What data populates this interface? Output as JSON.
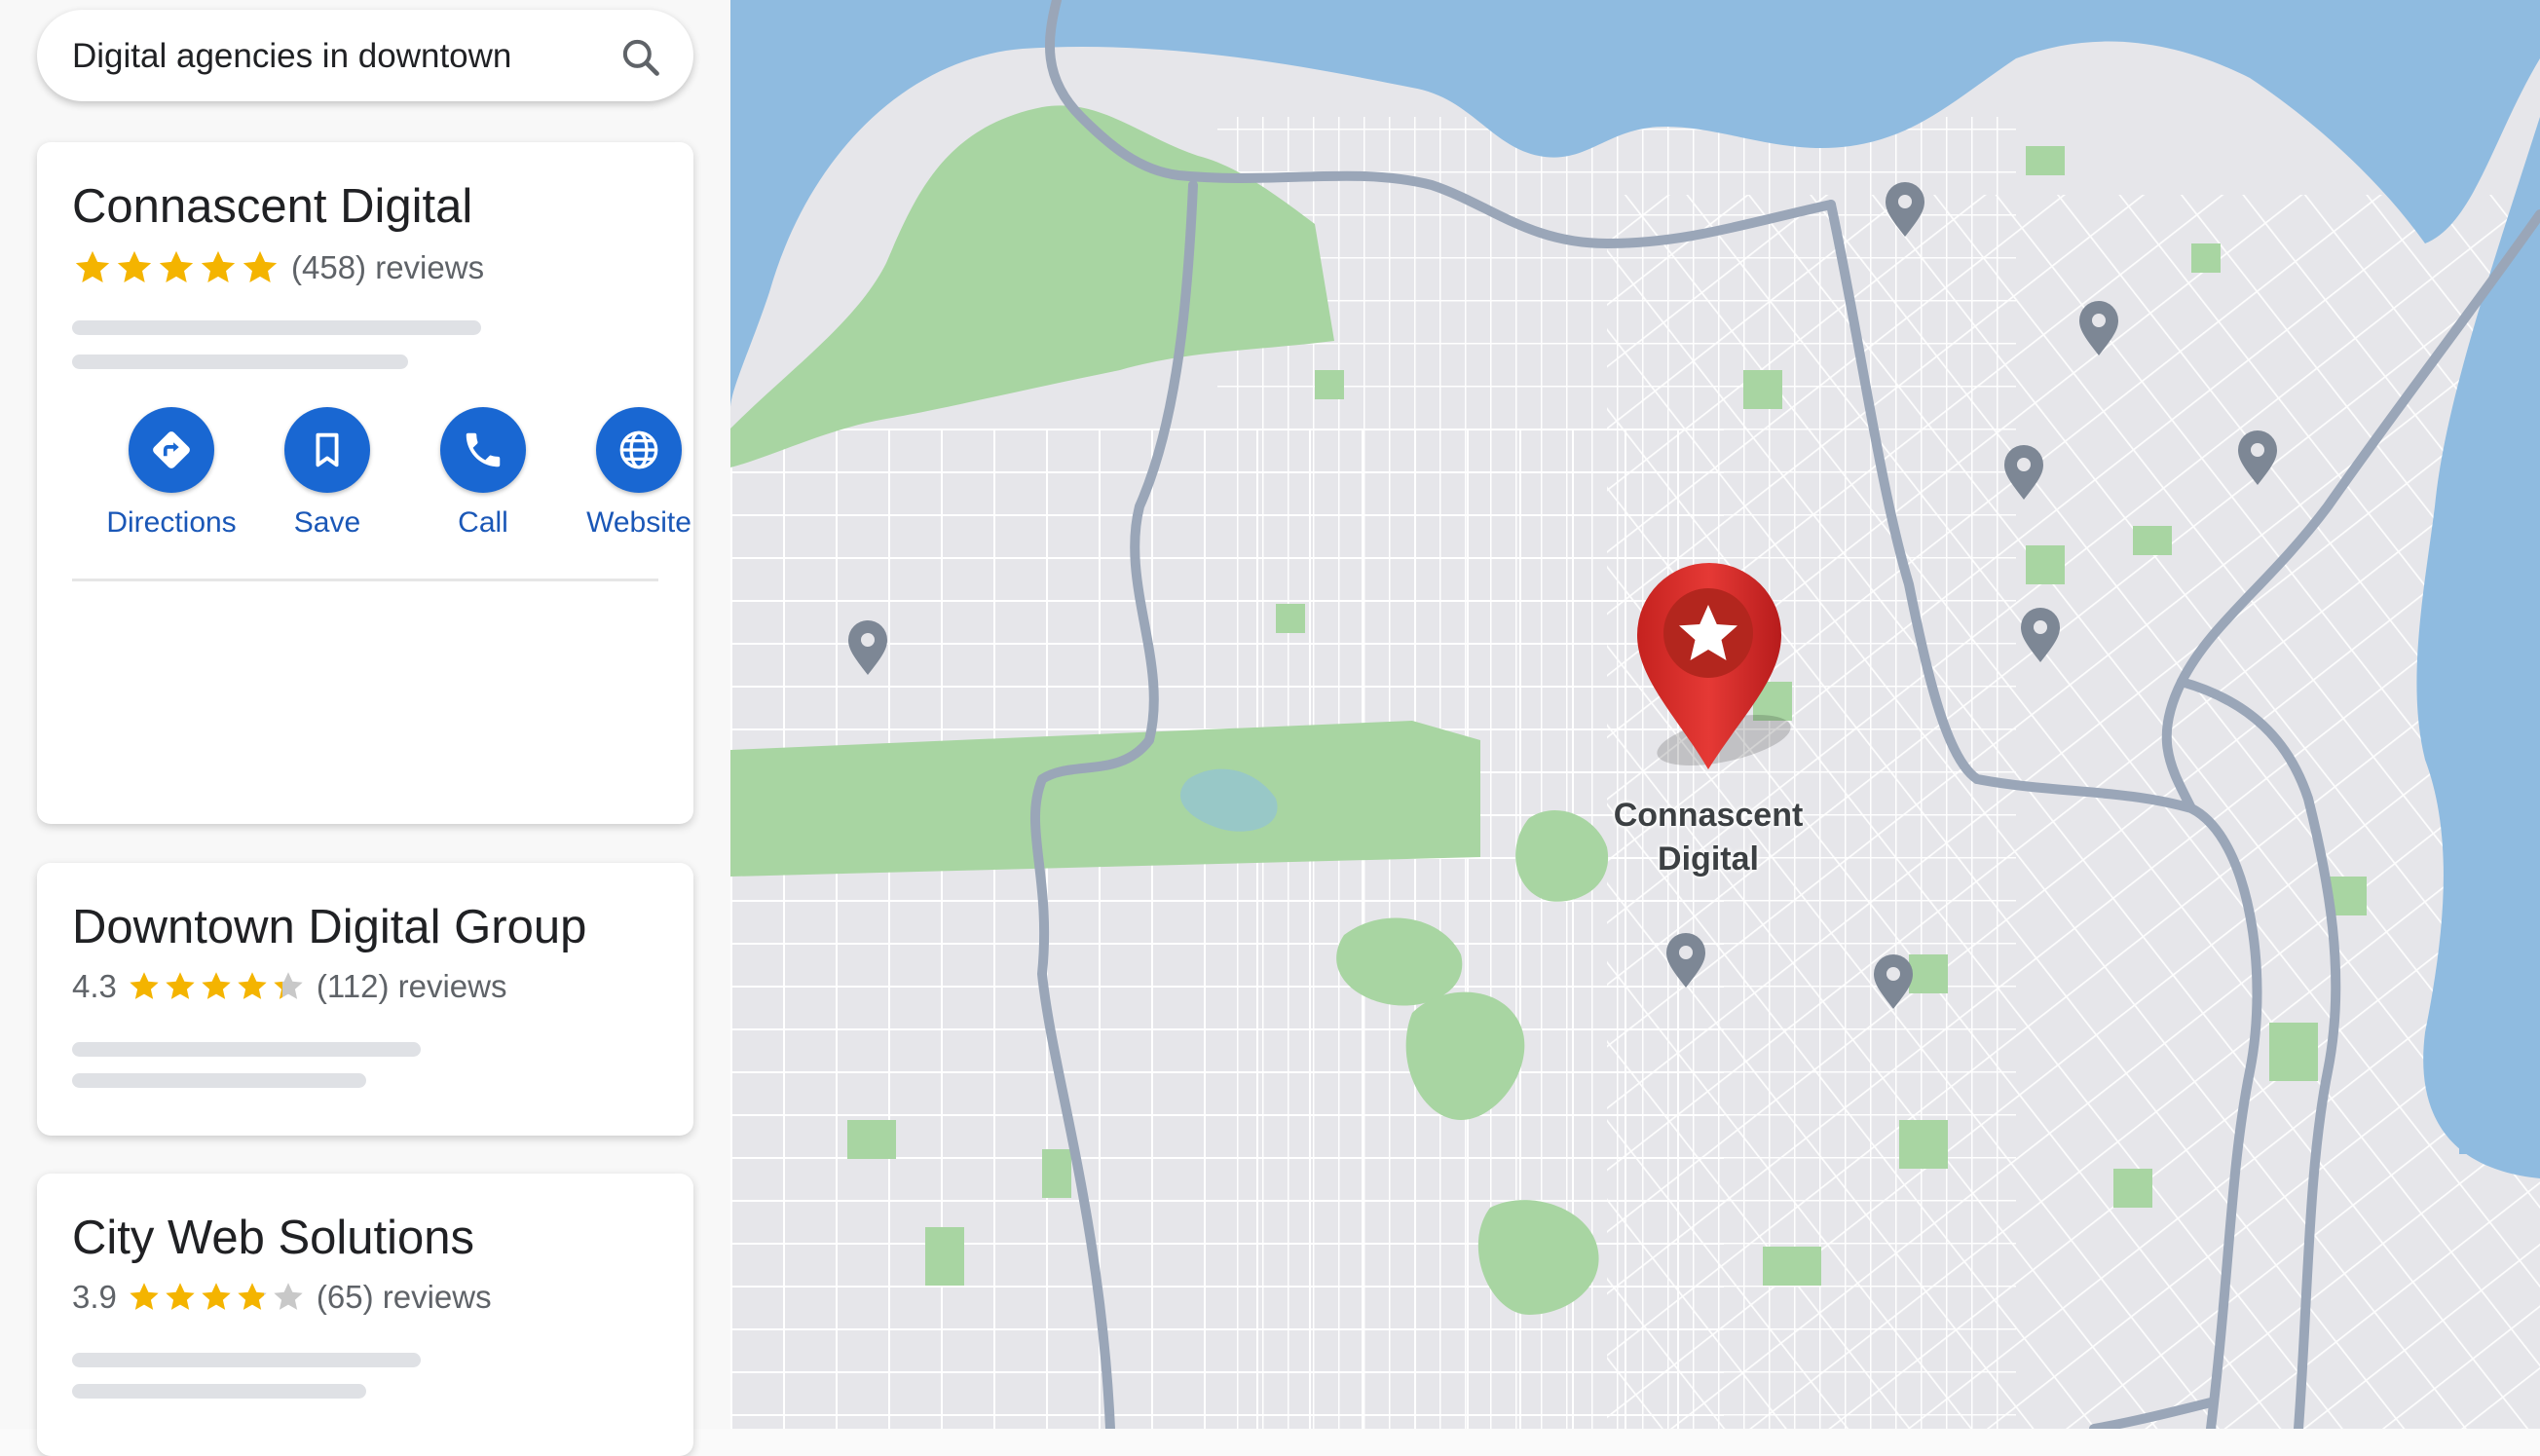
{
  "search": {
    "query": "Digital agencies in downtown",
    "icon": "search-icon"
  },
  "results": [
    {
      "name": "Connascent Digital",
      "rating": 5.0,
      "rating_text": "",
      "reviews": "(458) reviews",
      "actions": [
        {
          "label": "Directions",
          "icon": "directions-icon"
        },
        {
          "label": "Save",
          "icon": "bookmark-icon"
        },
        {
          "label": "Call",
          "icon": "phone-icon"
        },
        {
          "label": "Website",
          "icon": "globe-icon"
        }
      ]
    },
    {
      "name": "Downtown Digital Group",
      "rating": 4.3,
      "rating_text": "4.3",
      "reviews": "(112) reviews"
    },
    {
      "name": "City Web Solutions",
      "rating": 3.9,
      "rating_text": "3.9",
      "reviews": "(65) reviews"
    }
  ],
  "map": {
    "featured_pin": {
      "label_line1": "Connascent",
      "label_line2": "Digital",
      "color": "#d93025",
      "icon": "star-icon"
    },
    "colors": {
      "water": "#8fbbe0",
      "land": "#e6e6ea",
      "park": "#a8d5a2",
      "highway": "#9aa6b8",
      "pin": "#7d8795"
    }
  }
}
